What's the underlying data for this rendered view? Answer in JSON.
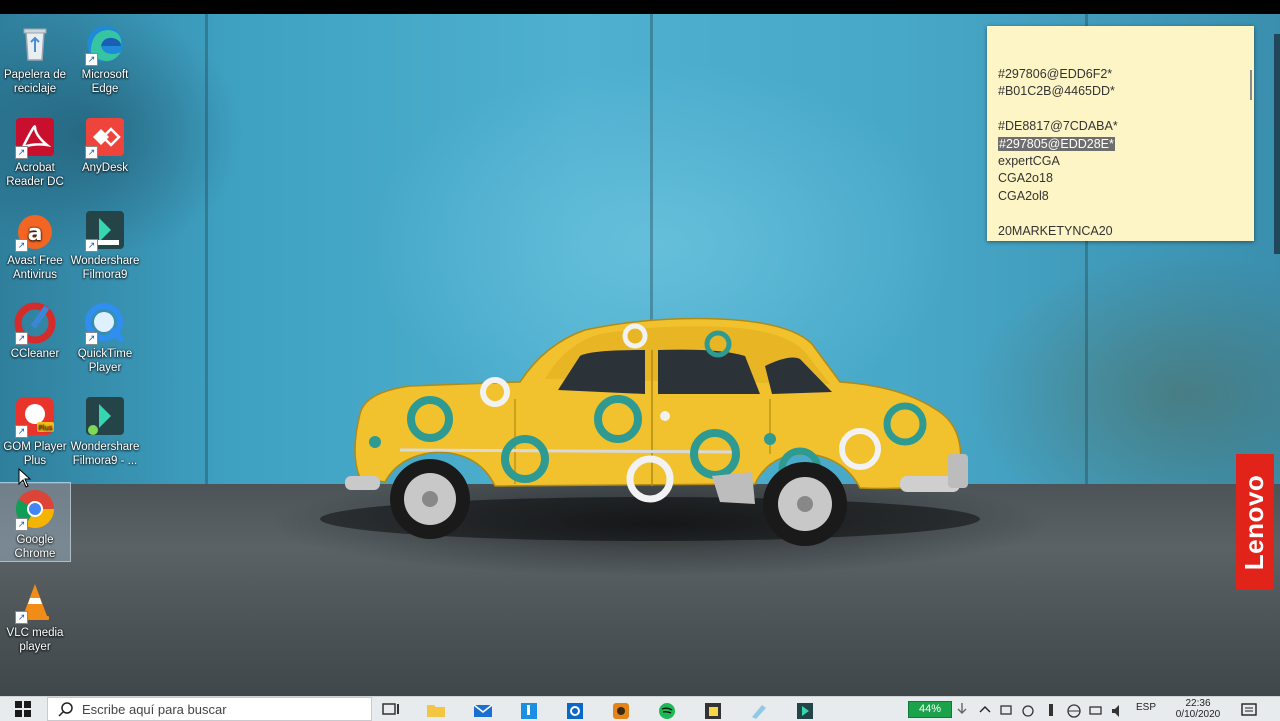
{
  "desktop": {
    "icons": [
      {
        "label": "Papelera de reciclaje",
        "icon": "recycle-bin-icon"
      },
      {
        "label": "Microsoft Edge",
        "icon": "edge-icon"
      },
      {
        "label": "Acrobat Reader DC",
        "icon": "acrobat-icon"
      },
      {
        "label": "AnyDesk",
        "icon": "anydesk-icon"
      },
      {
        "label": "Avast Free Antivirus",
        "icon": "avast-icon"
      },
      {
        "label": "Wondershare Filmora9",
        "icon": "filmora-icon"
      },
      {
        "label": "CCleaner",
        "icon": "ccleaner-icon"
      },
      {
        "label": "QuickTime Player",
        "icon": "quicktime-icon"
      },
      {
        "label": "GOM Player Plus",
        "icon": "gom-player-icon"
      },
      {
        "label": "Wondershare Filmora9 - ...",
        "icon": "filmora-icon"
      },
      {
        "label": "Google Chrome",
        "icon": "chrome-icon"
      },
      {
        "label": "VLC media player",
        "icon": "vlc-icon"
      }
    ]
  },
  "sticky_note": {
    "lines": [
      "#297806@EDD6F2*",
      "#B01C2B@4465DD*",
      "",
      "#DE8817@7CDABA*",
      "#297805@EDD28E*",
      "expertCGA",
      "CGA2o18",
      "CGA2ol8",
      "",
      "20MARKETYNCA20"
    ],
    "selected_line": "#297805@EDD28E*"
  },
  "wallpaper_badge": "Lenovo",
  "taskbar": {
    "search_placeholder": "Escribe aquí para buscar",
    "battery_percent": "44%",
    "language": "ESP",
    "time": "22:36",
    "date": "0/10/2020"
  },
  "colors": {
    "sticky_bg": "#fdf5c6",
    "taskbar_bg": "#e8ebee",
    "battery": "#1aa34a",
    "lenovo": "#e2231a",
    "car_yellow": "#f2c12e",
    "car_teal": "#2f9a92"
  }
}
